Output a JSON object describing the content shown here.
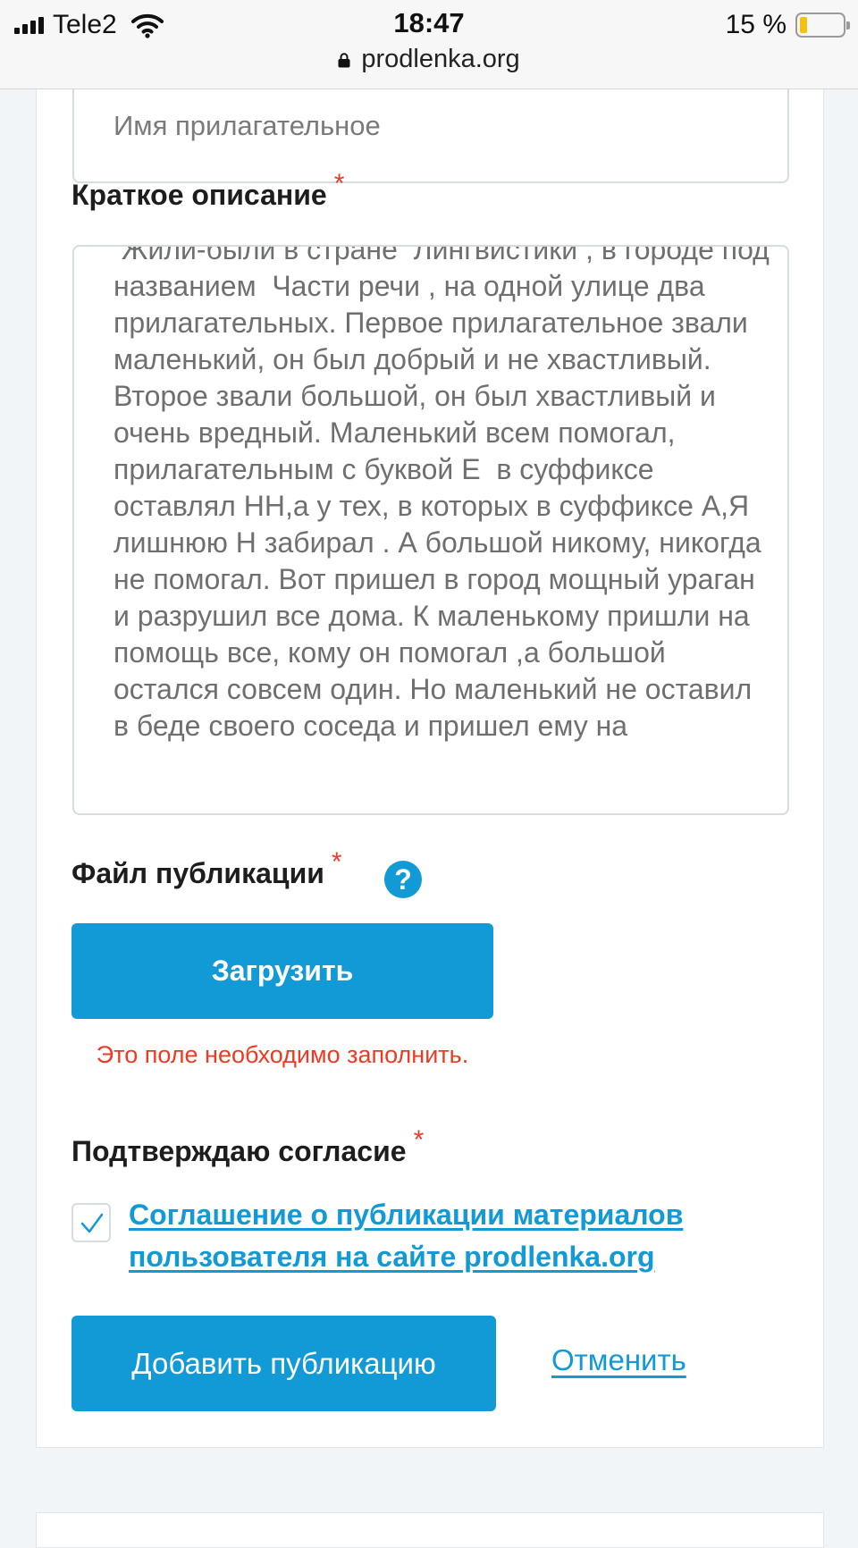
{
  "status_bar": {
    "carrier": "Tele2",
    "time": "18:47",
    "battery": "15 %",
    "url": "prodlenka.org"
  },
  "form": {
    "name_value": "Имя прилагательное",
    "description": {
      "label": "Краткое описание",
      "text": " Жили-были в стране  Лингвистики , в городе под названием  Части речи , на одной улице два прилагательных. Первое прилагательное звали маленький, он был добрый и не хвастливый. Второе звали большой, он был хвастливый и очень вредный. Маленький всем помогал, прилагательным с буквой Е  в суффиксе оставлял НН,а у тех, в которых в суффиксе А,Я лишнюю Н забирал . А большой никому, никогда не помогал. Вот пришел в город мощный ураган и разрушил все дома. К маленькому пришли на помощь все, кому он помогал ,а большой остался совсем один. Но маленький не оставил в беде своего соседа и пришел ему на"
    },
    "file": {
      "label": "Файл публикации",
      "help": "?",
      "upload_label": "Загрузить",
      "error": "Это поле необходимо заполнить."
    },
    "consent": {
      "label": "Подтверждаю согласие",
      "link": "Соглашение о публикации материалов пользователя на сайте prodlenka.org"
    },
    "required_mark": "*",
    "submit_label": "Добавить публикацию",
    "cancel_label": "Отменить"
  },
  "colors": {
    "accent": "#119ad6",
    "error": "#ee3a22",
    "required": "#e63b2e"
  }
}
